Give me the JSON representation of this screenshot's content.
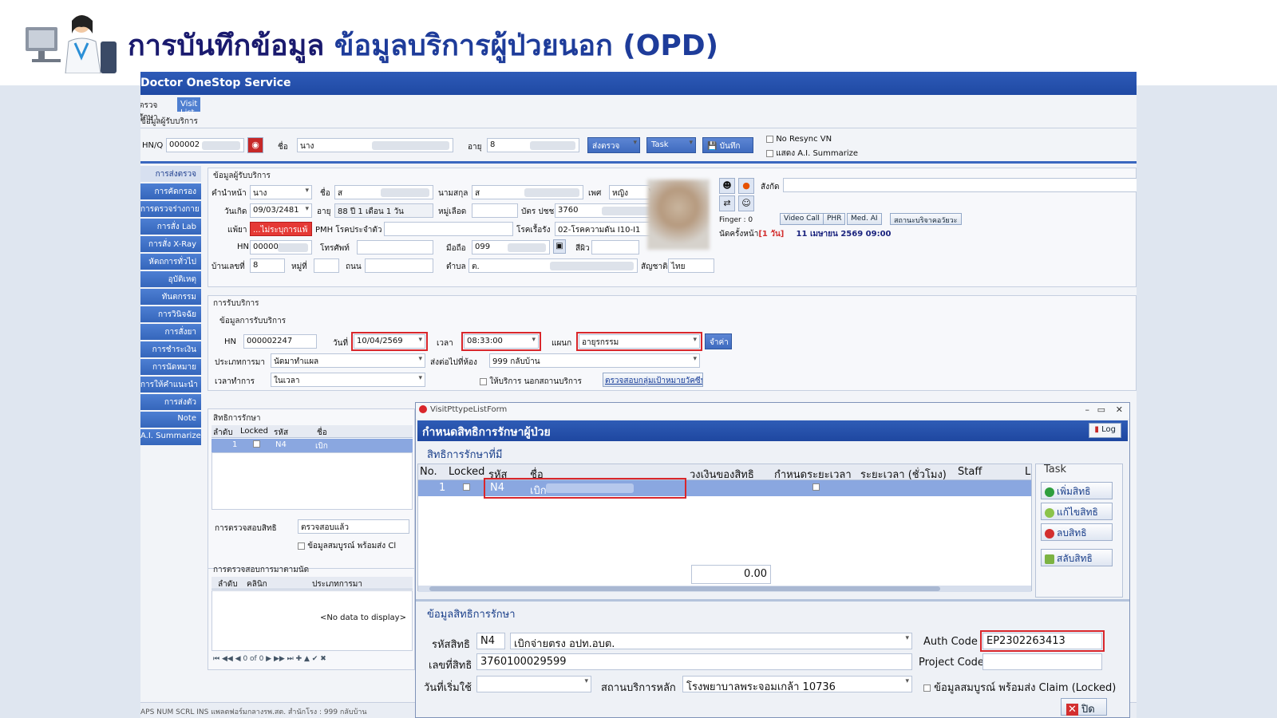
{
  "slide": {
    "title_prefix": "การบันทึกข้อมูล",
    "title_highlight": "ข้อมูลบริการผู้ป่วยนอก (OPD)"
  },
  "app": {
    "title": "Doctor OneStop Service",
    "tabs": [
      "ตรวจรักษา",
      "Visit List"
    ],
    "patient_section_label": "ข้อมูลผู้รับบริการ",
    "top": {
      "hnq_label": "HN/Q",
      "hnq_value": "000002",
      "name_label": "ชื่อ",
      "name_value": "นาง",
      "age_label": "อายุ",
      "age_value": "8",
      "send_btn": "ส่งตรวจ",
      "task_btn": "Task",
      "save_btn": "บันทึก",
      "no_resync": "No Resync VN",
      "show_ai": "แสดง A.I. Summarize"
    },
    "sidebar": [
      "การส่งตรวจ",
      "การคัดกรอง",
      "การตรวจร่างกาย",
      "การสั่ง Lab",
      "การสั่ง X-Ray",
      "หัตถการทั่วไป",
      "อุบัติเหตุ",
      "ทันตกรรม",
      "การวินิจฉัย",
      "การสั่งยา",
      "การชำระเงิน",
      "การนัดหมาย",
      "การให้คำแนะนำ",
      "การส่งตัว",
      "Note",
      "A.I. Summarize"
    ],
    "patient": {
      "section": "ข้อมูลผู้รับบริการ",
      "prefix_label": "คำนำหน้า",
      "prefix_value": "นาง",
      "fname_label": "ชื่อ",
      "fname_value": "ส",
      "lname_label": "นามสกุล",
      "lname_value": "ส",
      "sex_label": "เพศ",
      "sex_value": "หญิง",
      "dob_label": "วันเกิด",
      "dob_value": "09/03/2481",
      "age_label": "อายุ",
      "age_value": "88 ปี 1 เดือน 1 วัน",
      "blood_label": "หมู่เลือด",
      "blood_value": "",
      "cid_label": "บัตร ปชช.",
      "cid_value": "3760",
      "allergy_label": "แพ้ยา",
      "allergy_value": "...ไม่ระบุการแพ้",
      "pmh_label": "PMH โรคประจำตัว",
      "pmh_value": "",
      "chronic_label": "โรคเรื้อรัง",
      "chronic_value": "02-โรคความดัน I10-I1",
      "hn_label": "HN",
      "hn_value": "000002",
      "phone_label": "โทรศัพท์",
      "phone_value": "",
      "mobile_label": "มือถือ",
      "mobile_value": "099",
      "skin_label": "สีผิว",
      "skin_value": "",
      "house_label": "บ้านเลขที่",
      "house_value": "8",
      "moo_label": "หมู่ที่",
      "moo_value": "",
      "road_label": "ถนน",
      "road_value": "",
      "tambon_label": "ตำบล",
      "tambon_value": "ต.",
      "nation_label": "สัญชาติ",
      "nation_value": "ไทย",
      "affil_label": "สังกัด",
      "finger_label": "Finger : 0",
      "appoint_label": "นัดครั้งหน้า",
      "appoint_days": "[1 วัน]",
      "appoint_date": "11 เมษายน 2569 09:00",
      "btn_video": "Video Call",
      "btn_phr": "PHR",
      "btn_medai": "Med. AI",
      "btn_status": "สถานะบริจาคอวัยวะ"
    },
    "service": {
      "section": "การรับบริการ",
      "subsection": "ข้อมูลการรับบริการ",
      "hn_label": "HN",
      "hn_value": "000002247",
      "date_label": "วันที่",
      "date_value": "10/04/2569",
      "time_label": "เวลา",
      "time_value": "08:33:00",
      "dept_label": "แผนก",
      "dept_value": "อายุรกรรม",
      "dept_btn": "จำค่า",
      "visit_type_label": "ประเภทการมา",
      "visit_type_value": "นัดมาทำแผล",
      "send_room_label": "ส่งต่อไปที่ห้อง",
      "send_room_value": "999 กลับบ้าน",
      "time_op_label": "เวลาทำการ",
      "time_op_value": "ในเวลา",
      "outside_label": "ให้บริการ นอกสถานบริการ",
      "target_btn": "ตรวจสอบกลุ่มเป้าหมายวัคซีน"
    },
    "rights_left": {
      "section": "สิทธิการรักษา",
      "cols": [
        "ลำดับ",
        "Locked",
        "รหัส",
        "ชื่อ"
      ],
      "row": {
        "no": "1",
        "code": "N4",
        "name": "เบิก"
      },
      "verify_label": "การตรวจสอบสิทธิ",
      "verify_value": "ตรวจสอบแล้ว",
      "complete_label": "ข้อมูลสมบูรณ์ พร้อมส่ง Cl"
    },
    "appt_check": {
      "section": "การตรวจสอบการมาตามนัด",
      "cols": [
        "ลำดับ",
        "คลินิก",
        "ประเภทการมา"
      ],
      "empty": "<No data to display>",
      "pager": "0 of 0"
    },
    "statusbar": "APS   NUM   SCRL   INS    แพลตฟอร์มกลางรพ.สต. สำนักโรง : 999 กลับบ้าน"
  },
  "dialog": {
    "window_title": "VisitPttypeListForm",
    "heading": "กำหนดสิทธิการรักษาผู้ป่วย",
    "log_btn": "Log",
    "existing_label": "สิทธิการรักษาที่มี",
    "cols": [
      "No.",
      "Locked",
      "รหัส",
      "ชื่อ",
      "วงเงินของสิทธิ",
      "กำหนดระยะเวลา",
      "ระยะเวลา (ชั่วโมง)",
      "Staff",
      "L"
    ],
    "row": {
      "no": "1",
      "code": "N4",
      "name": "เบิก"
    },
    "total": "0.00",
    "task_label": "Task",
    "task_buttons": [
      "เพิ่มสิทธิ",
      "แก้ไขสิทธิ",
      "ลบสิทธิ",
      "สลับสิทธิ"
    ],
    "detail_section": "ข้อมูลสิทธิการรักษา",
    "right_code_label": "รหัสสิทธิ",
    "right_code_value": "N4",
    "right_name_value": "เบิกจ่ายตรง อปท.อบต.",
    "auth_label": "Auth Code",
    "auth_value": "EP2302263413",
    "right_no_label": "เลขที่สิทธิ",
    "right_no_value": "3760100029599",
    "project_label": "Project Code",
    "project_value": "",
    "start_label": "วันที่เริ่มใช้",
    "start_value": "",
    "main_hosp_label": "สถานบริการหลัก",
    "main_hosp_value": "โรงพยาบาลพระจอมเกล้า 10736",
    "complete_label": "ข้อมูลสมบูรณ์ พร้อมส่ง Claim (Locked)",
    "close_btn": "ปิด"
  },
  "colors": {
    "accent": "#1f49a3",
    "highlight": "#d9262b",
    "selected_row": "#8aa7e0"
  }
}
